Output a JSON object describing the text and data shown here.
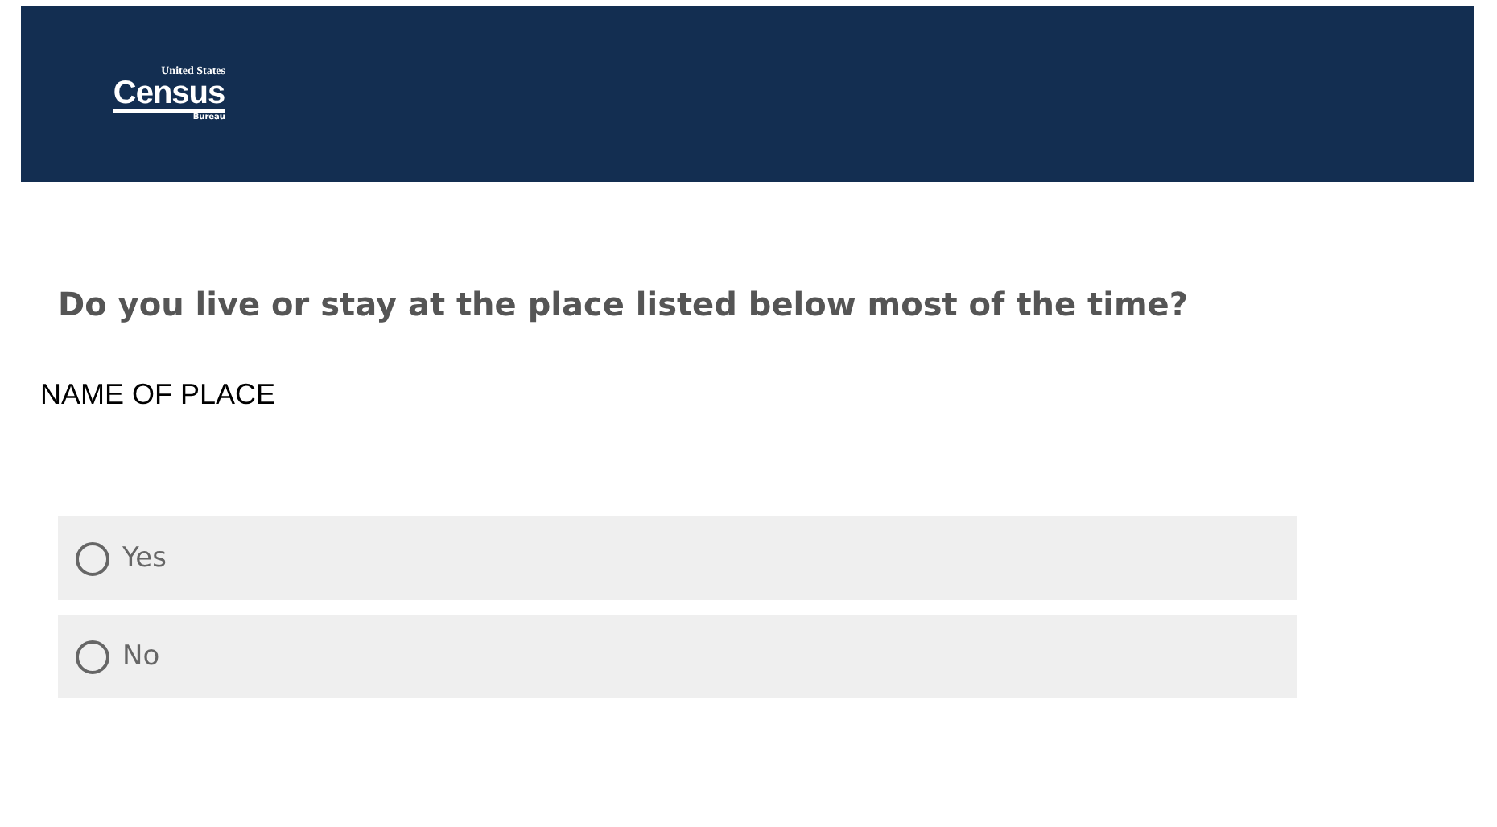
{
  "header": {
    "logo": {
      "top": "United States",
      "main": "Census",
      "bottom": "Bureau"
    }
  },
  "question": "Do you live or stay at the place listed below most of the time?",
  "place": "NAME OF PLACE",
  "options": [
    {
      "label": "Yes",
      "selected": false
    },
    {
      "label": "No",
      "selected": false
    }
  ]
}
